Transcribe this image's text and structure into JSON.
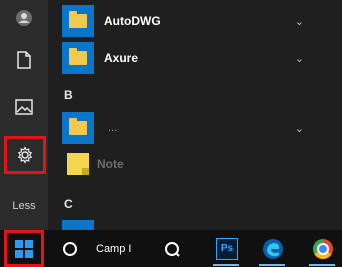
{
  "rail": {
    "items": [
      {
        "name": "user",
        "icon": "user-icon"
      },
      {
        "name": "documents",
        "icon": "document-icon"
      },
      {
        "name": "pictures",
        "icon": "image-icon"
      },
      {
        "name": "settings",
        "icon": "gear-icon"
      },
      {
        "name": "less",
        "label": "Less"
      }
    ]
  },
  "apps": {
    "rows": [
      {
        "label": "AutoDWG",
        "icon": "folder-icon",
        "expand": "⌄"
      },
      {
        "label": "Axure",
        "icon": "folder-icon",
        "expand": "⌄"
      }
    ],
    "section_b": "B",
    "faded_label": "...",
    "partial_app": "Note",
    "section_c": "C"
  },
  "taskbar": {
    "search_text": "Camp I",
    "items": [
      "start-button",
      "cortana-circle",
      "search-field",
      "task-view",
      "photoshop",
      "edge",
      "chrome"
    ],
    "ps_label": "Ps"
  },
  "colors": {
    "highlight": "#e0161b",
    "accent": "#0a76c9",
    "taskbar_bg": "#101010"
  }
}
